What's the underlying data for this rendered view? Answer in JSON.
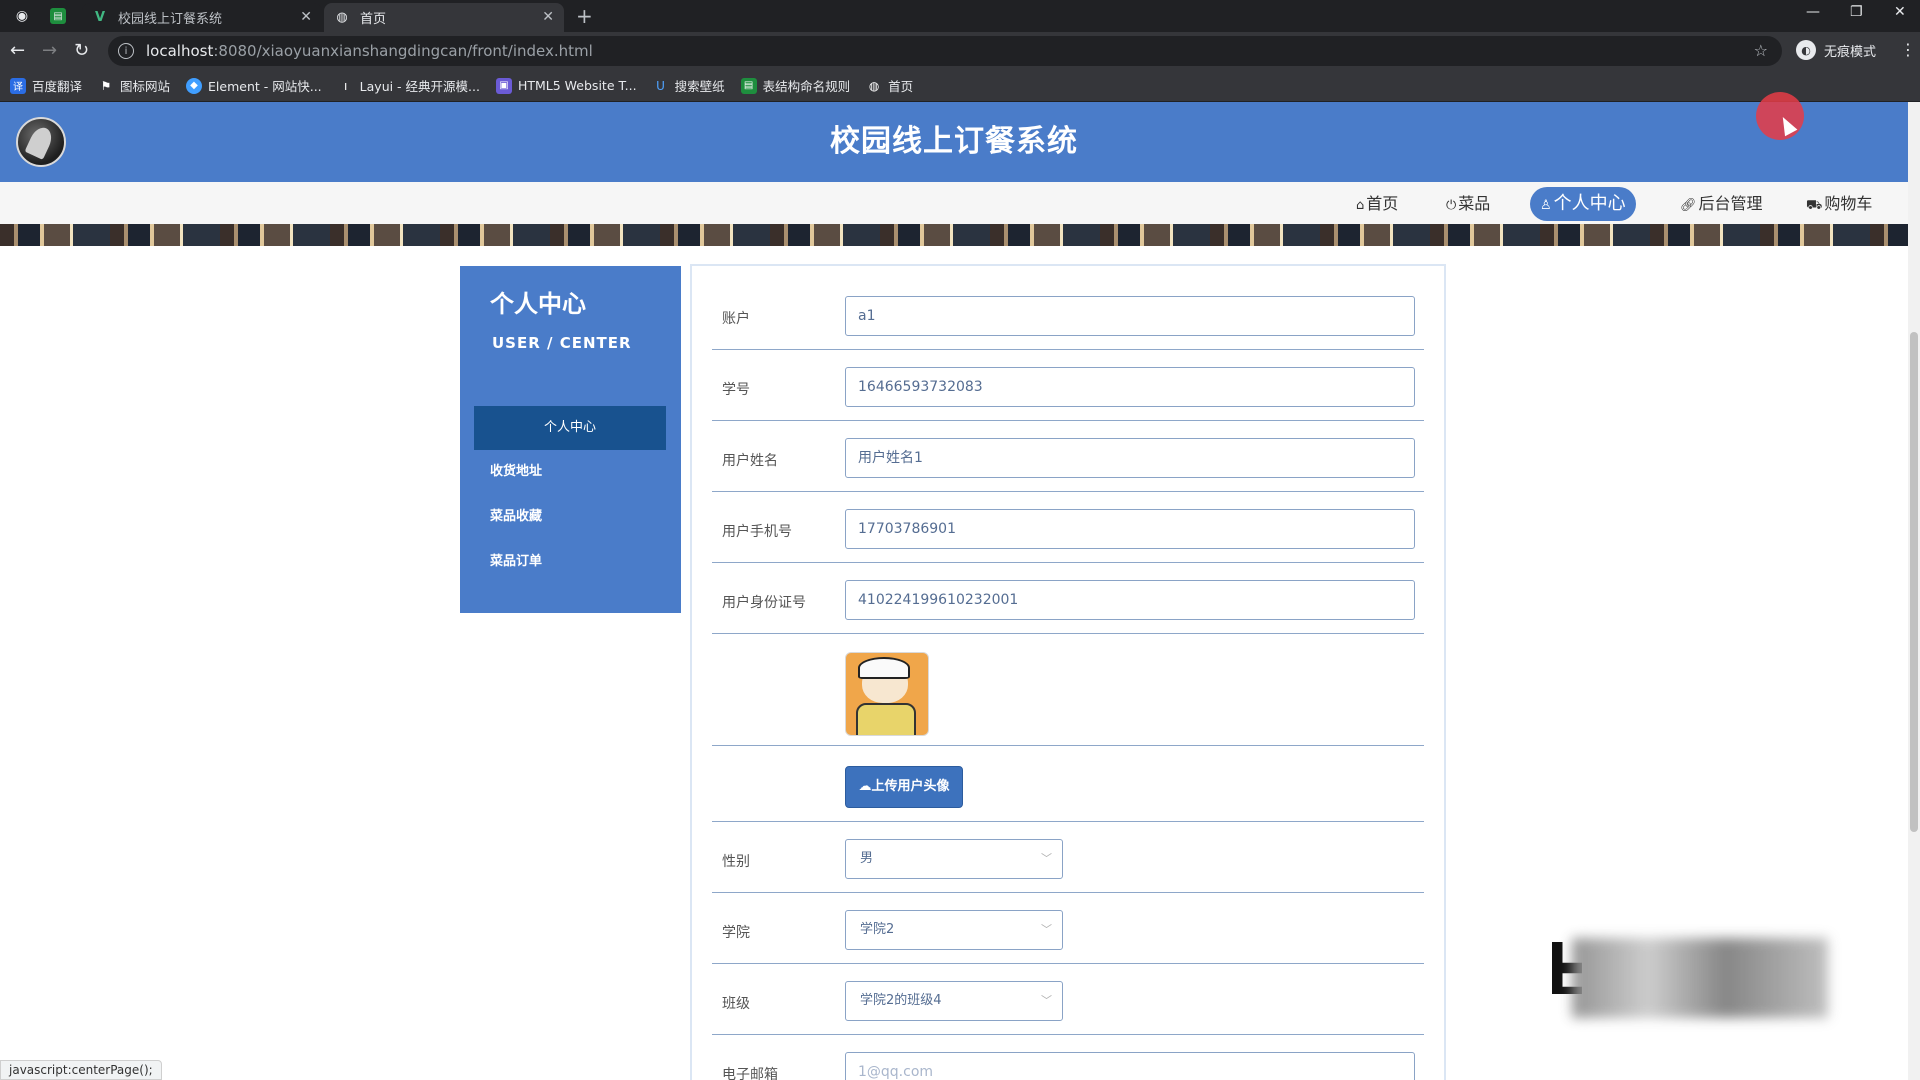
{
  "browser": {
    "tabs": [
      {
        "title": "校园线上订餐系统",
        "icon": "vue-icon"
      },
      {
        "title": "首页",
        "icon": "globe-icon"
      }
    ],
    "url_host": "localhost",
    "url_path": ":8080/xiaoyuanxianshangdingcan/front/index.html",
    "incognito_label": "无痕模式",
    "bookmarks": [
      "百度翻译",
      "图标网站",
      "Element - 网站快...",
      "Layui - 经典开源模...",
      "HTML5 Website T...",
      "搜索壁纸",
      "表结构命名规则",
      "首页"
    ],
    "status_text": "javascript:centerPage();"
  },
  "site": {
    "title": "校园线上订餐系统",
    "nav": [
      {
        "label": "首页",
        "icon": "home-icon"
      },
      {
        "label": "菜品",
        "icon": "power-icon"
      },
      {
        "label": "个人中心",
        "icon": "user-icon"
      },
      {
        "label": "后台管理",
        "icon": "link-icon"
      },
      {
        "label": "购物车",
        "icon": "cart-icon"
      }
    ],
    "active_nav": "个人中心"
  },
  "sidebar": {
    "title": "个人中心",
    "subtitle": "USER / CENTER",
    "items": [
      "个人中心",
      "收货地址",
      "菜品收藏",
      "菜品订单"
    ]
  },
  "form": {
    "account": {
      "label": "账户",
      "value": "a1"
    },
    "student_id": {
      "label": "学号",
      "value": "16466593732083"
    },
    "name": {
      "label": "用户姓名",
      "value": "用户姓名1"
    },
    "phone": {
      "label": "用户手机号",
      "value": "17703786901"
    },
    "id_card": {
      "label": "用户身份证号",
      "value": "410224199610232001"
    },
    "upload_label": "上传用户头像",
    "gender": {
      "label": "性别",
      "value": "男"
    },
    "college": {
      "label": "学院",
      "value": "学院2"
    },
    "class": {
      "label": "班级",
      "value": "学院2的班级4"
    },
    "email": {
      "label": "电子邮箱",
      "value": "1@qq.com"
    }
  },
  "colors": {
    "brand": "#4a7cc9",
    "sidebar_active": "#18528f",
    "cursor_highlight": "#e63c46"
  }
}
